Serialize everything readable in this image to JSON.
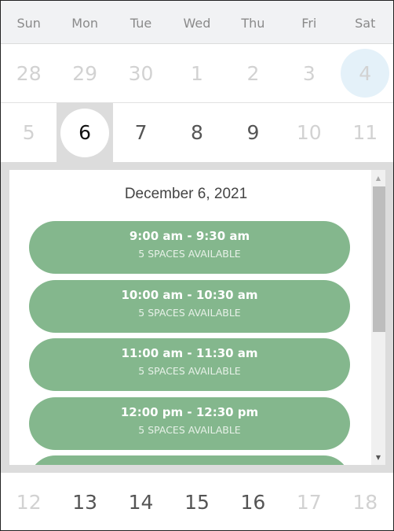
{
  "weekdays": [
    "Sun",
    "Mon",
    "Tue",
    "Wed",
    "Thu",
    "Fri",
    "Sat"
  ],
  "weeks": [
    {
      "days": [
        {
          "label": "28",
          "state": "outside"
        },
        {
          "label": "29",
          "state": "outside"
        },
        {
          "label": "30",
          "state": "outside"
        },
        {
          "label": "1",
          "state": "unavailable"
        },
        {
          "label": "2",
          "state": "unavailable"
        },
        {
          "label": "3",
          "state": "unavailable"
        },
        {
          "label": "4",
          "state": "today"
        }
      ]
    },
    {
      "days": [
        {
          "label": "5",
          "state": "unavailable"
        },
        {
          "label": "6",
          "state": "selected"
        },
        {
          "label": "7",
          "state": "available"
        },
        {
          "label": "8",
          "state": "available"
        },
        {
          "label": "9",
          "state": "available"
        },
        {
          "label": "10",
          "state": "unavailable"
        },
        {
          "label": "11",
          "state": "unavailable"
        }
      ]
    },
    {
      "days": [
        {
          "label": "12",
          "state": "unavailable"
        },
        {
          "label": "13",
          "state": "available"
        },
        {
          "label": "14",
          "state": "available"
        },
        {
          "label": "15",
          "state": "available"
        },
        {
          "label": "16",
          "state": "available"
        },
        {
          "label": "17",
          "state": "unavailable"
        },
        {
          "label": "18",
          "state": "unavailable"
        }
      ]
    }
  ],
  "slots_panel": {
    "title": "December 6, 2021",
    "slots": [
      {
        "time": "9:00 am - 9:30 am",
        "availability": "5 SPACES AVAILABLE"
      },
      {
        "time": "10:00 am - 10:30 am",
        "availability": "5 SPACES AVAILABLE"
      },
      {
        "time": "11:00 am - 11:30 am",
        "availability": "5 SPACES AVAILABLE"
      },
      {
        "time": "12:00 pm - 12:30 pm",
        "availability": "5 SPACES AVAILABLE"
      },
      {
        "time": "",
        "availability": ""
      }
    ],
    "scroll_up_icon": "▲",
    "scroll_down_icon": "▼"
  },
  "colors": {
    "slot_green": "#84b78d",
    "selected_bg": "#dcdcdc",
    "today_circle": "#e4f1f9",
    "header_bg": "#f1f2f4"
  }
}
